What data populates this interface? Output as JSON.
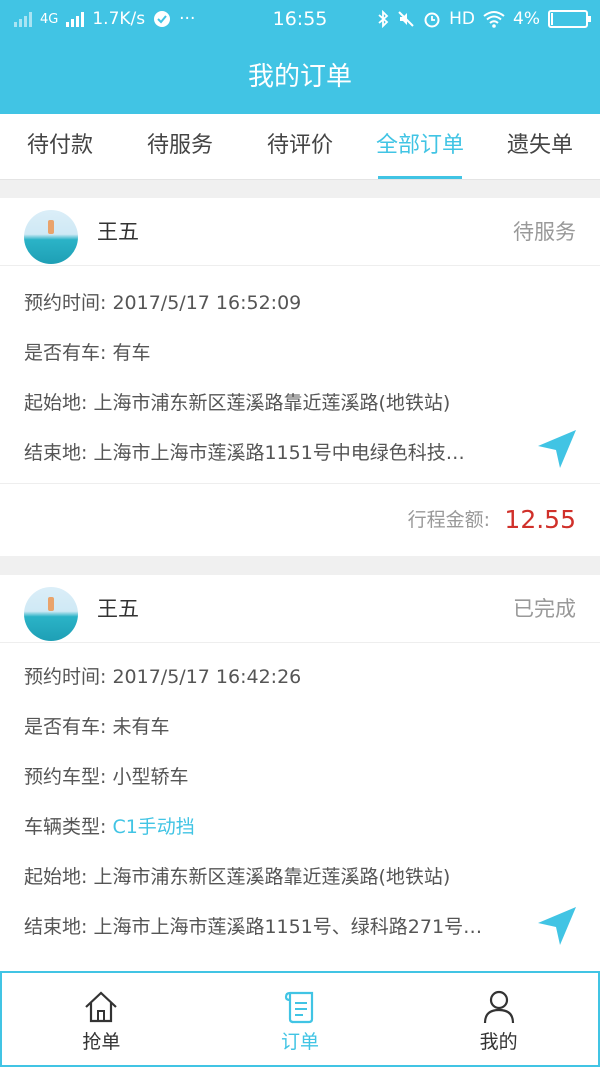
{
  "status_bar": {
    "network": "4G",
    "speed": "1.7K/s",
    "more": "···",
    "time": "16:55",
    "hd": "HD",
    "battery": "4%"
  },
  "navbar": {
    "title": "我的订单"
  },
  "tabs": [
    {
      "label": "待付款"
    },
    {
      "label": "待服务"
    },
    {
      "label": "待评价"
    },
    {
      "label": "全部订单"
    },
    {
      "label": "遗失单"
    }
  ],
  "orders": [
    {
      "name": "王五",
      "status": "待服务",
      "appointment_label": "预约时间: ",
      "appointment_value": "2017/5/17 16:52:09",
      "has_car_label": "是否有车: ",
      "has_car_value": "有车",
      "start_label": "起始地: ",
      "start_value": "上海市浦东新区莲溪路靠近莲溪路(地铁站)",
      "end_label": "结束地: ",
      "end_value": "上海市上海市莲溪路1151号中电绿色科技…",
      "amount_label": "行程金额:",
      "amount": "12.55"
    },
    {
      "name": "王五",
      "status": "已完成",
      "appointment_label": "预约时间: ",
      "appointment_value": "2017/5/17 16:42:26",
      "has_car_label": "是否有车: ",
      "has_car_value": "未有车",
      "car_model_label": "预约车型: ",
      "car_model_value": "小型轿车",
      "vehicle_type_label": "车辆类型: ",
      "vehicle_type_value": "C1手动挡",
      "start_label": "起始地: ",
      "start_value": "上海市浦东新区莲溪路靠近莲溪路(地铁站)",
      "end_label": "结束地: ",
      "end_value": "上海市上海市莲溪路1151号、绿科路271号…"
    }
  ],
  "bottom_nav": [
    {
      "label": "抢单",
      "icon": "home-icon"
    },
    {
      "label": "订单",
      "icon": "order-scroll-icon"
    },
    {
      "label": "我的",
      "icon": "user-icon"
    }
  ],
  "colors": {
    "primary": "#41c4e4",
    "amount": "#d0302a",
    "muted": "#999999"
  }
}
